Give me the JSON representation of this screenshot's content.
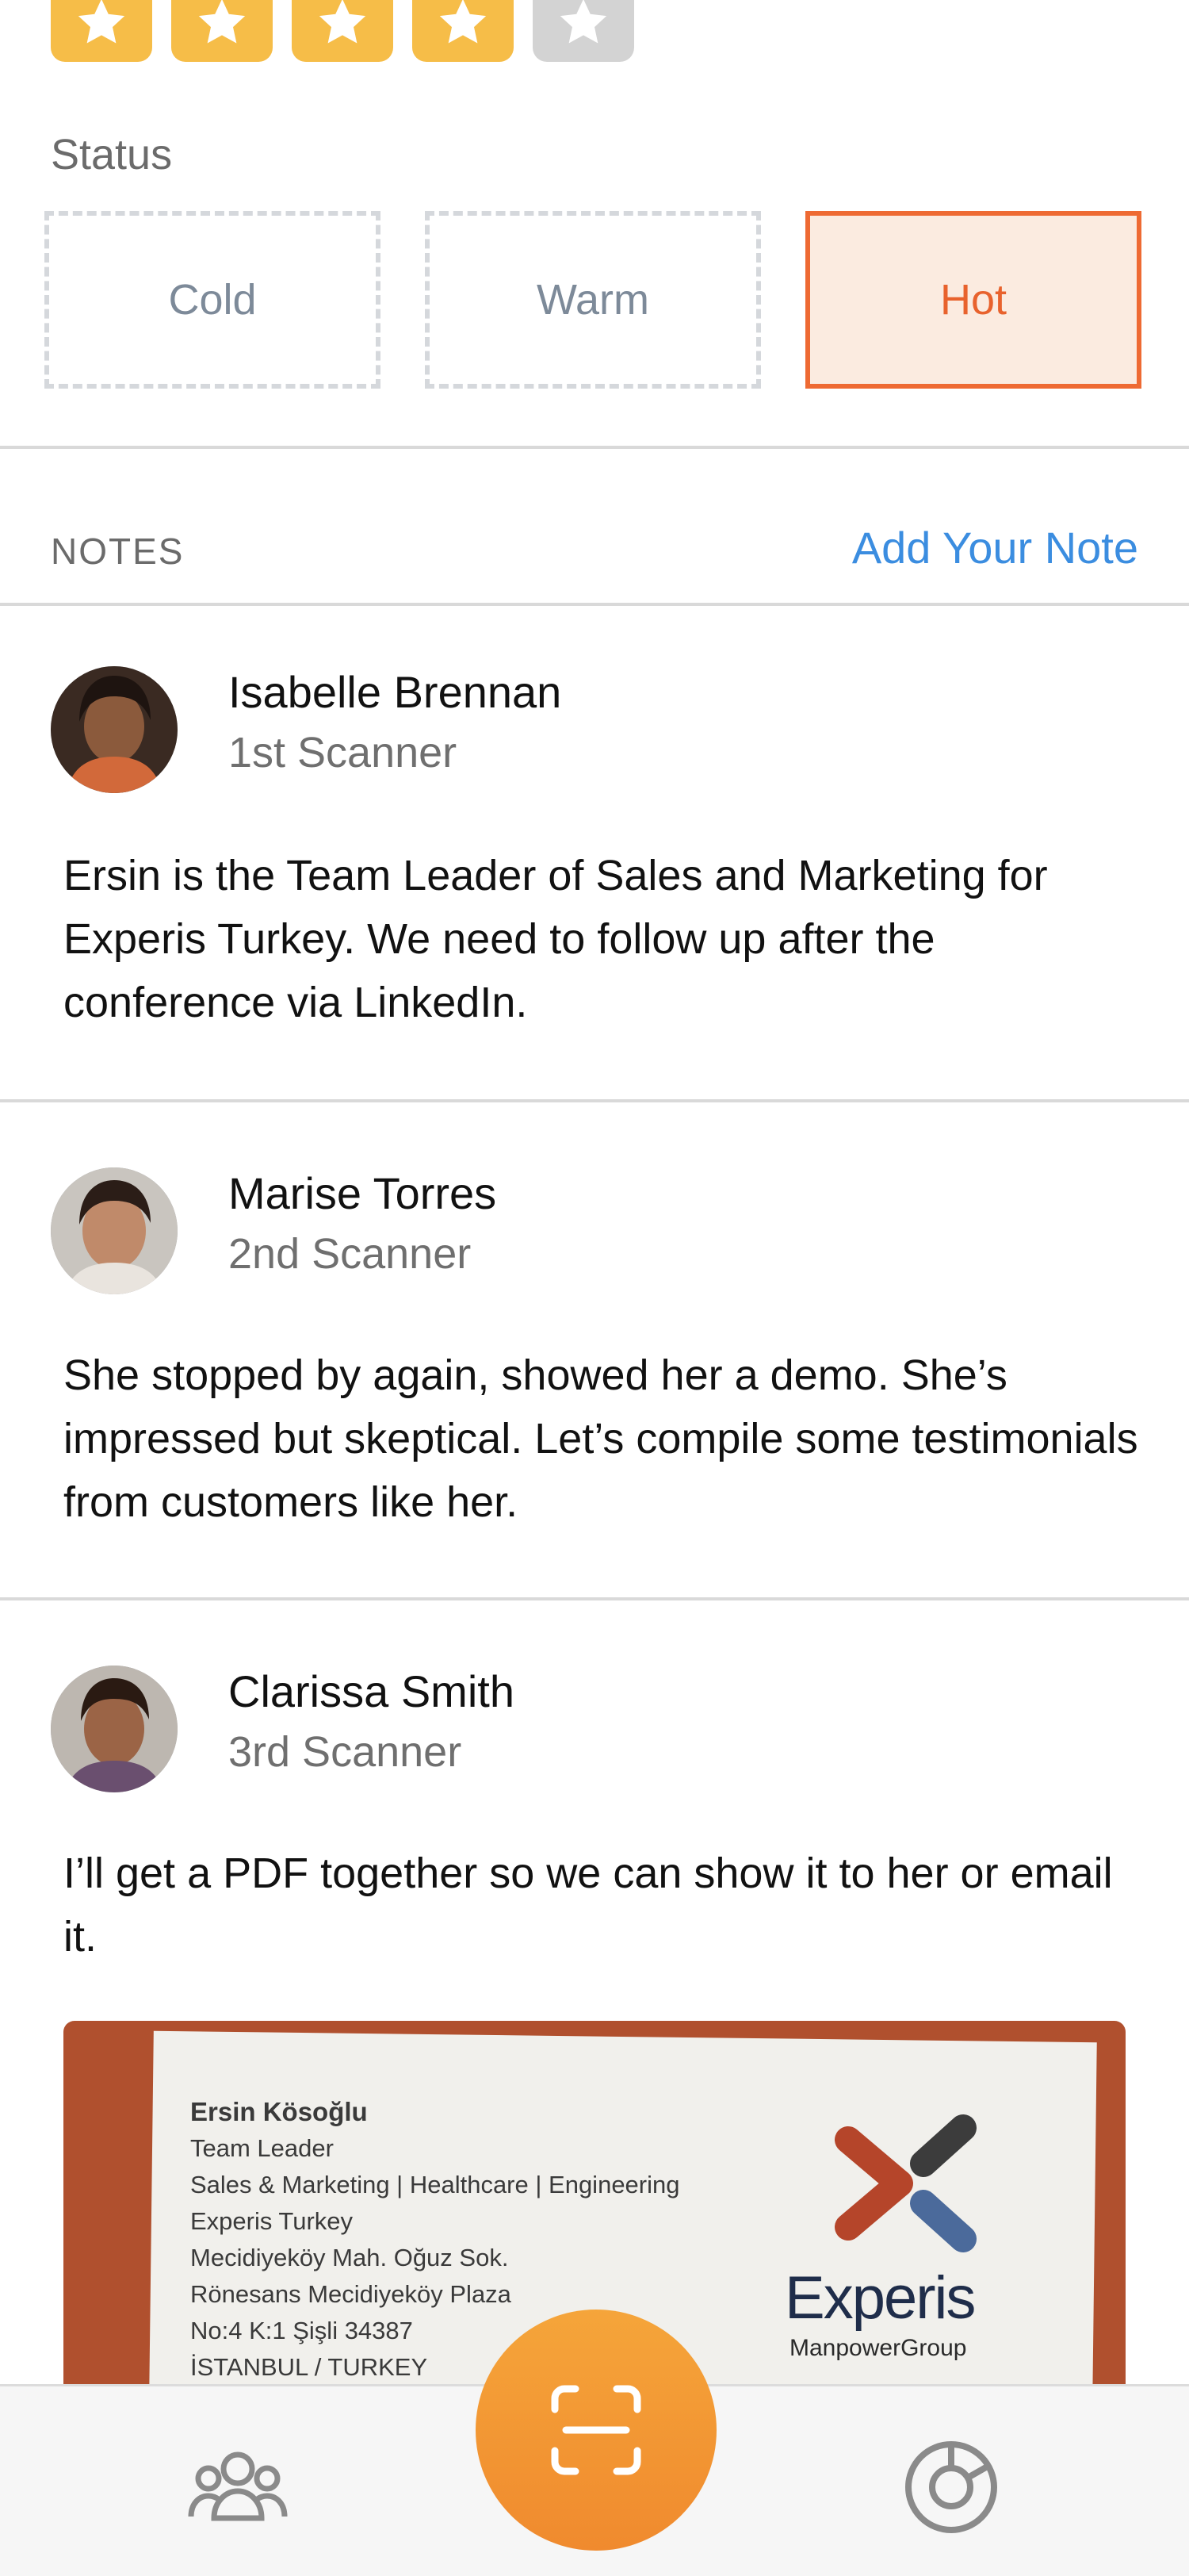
{
  "rating": {
    "value": 4,
    "max": 5,
    "filled_color": "#f6bd48",
    "empty_color": "#d3d3d3"
  },
  "status": {
    "label": "Status",
    "options": [
      "Cold",
      "Warm",
      "Hot"
    ],
    "selected": "Hot",
    "selected_color": "#ee6a33"
  },
  "notes": {
    "title": "NOTES",
    "add_label": "Add Your Note",
    "items": [
      {
        "name": "Isabelle Brennan",
        "role": "1st Scanner",
        "text": "Ersin is the Team Leader of Sales and Marketing for Experis Turkey. We need to follow up after the conference via LinkedIn."
      },
      {
        "name": "Marise Torres",
        "role": "2nd Scanner",
        "text": "She stopped by again, showed her a demo. She’s impressed but skeptical. Let’s compile some testimonials from customers like her."
      },
      {
        "name": "Clarissa Smith",
        "role": "3rd Scanner",
        "text": "I’ll get a PDF together so we can show it to her or email it."
      }
    ]
  },
  "business_card": {
    "lines": [
      "Ersin Kösoğlu",
      "Team Leader",
      "Sales & Marketing | Healthcare | Engineering",
      "Experis Turkey",
      "Mecidiyeköy Mah. Oğuz Sok.",
      "Rönesans Mecidiyeköy Plaza",
      "No:4 K:1 Şişli 34387",
      "İSTANBUL / TURKEY"
    ],
    "brand": "Experis",
    "brand_sub": "ManpowerGroup"
  },
  "tabbar": {
    "icons": [
      "people-icon",
      "scan-icon",
      "pie-chart-icon"
    ],
    "accent": "#f0922f"
  }
}
